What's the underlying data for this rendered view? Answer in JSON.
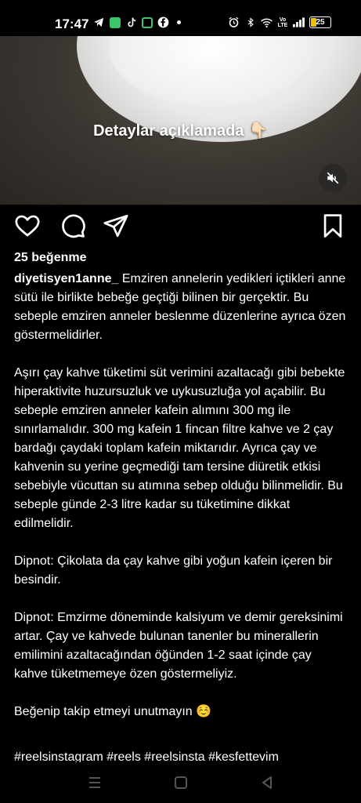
{
  "status_bar": {
    "time": "17:47",
    "battery_level": "25",
    "left_icons": [
      "telegram-icon",
      "messages-icon",
      "tiktok-icon",
      "app-icon",
      "facebook-icon",
      "more-dot"
    ],
    "right_icons": [
      "alarm-icon",
      "bluetooth-icon",
      "wifi-icon",
      "volte-icon",
      "signal-icon",
      "battery-icon"
    ],
    "volte_label": "Vo LTE"
  },
  "video": {
    "overlay_text": "Detaylar açıklamada 👇🏻",
    "muted": true
  },
  "post": {
    "likes_text": "25 beğenme",
    "username": "diyetisyen1anne_",
    "caption_first": "Emziren annelerin yedikleri içtikleri anne sütü ile birlikte bebeğe geçtiği bilinen bir gerçektir. Bu sebeple emziren anneler beslenme düzenlerine ayrıca özen göstermelidirler.",
    "paragraphs": [
      "Aşırı çay kahve tüketimi süt verimini azaltacağı gibi bebekte hiperaktivite huzursuzluk ve uykusuzluğa yol açabilir. Bu sebeple emziren anneler kafein alımını 300 mg ile sınırlamalıdır. 300 mg kafein 1 fincan filtre kahve ve 2 çay bardağı çaydaki toplam kafein miktarıdır. Ayrıca çay ve kahvenin su yerine geçmediği tam tersine diüretik etkisi sebebiyle vücuttan su atımına sebep olduğu bilinmelidir. Bu sebeple günde 2-3 litre kadar su tüketimine dikkat edilmelidir.",
      "Dipnot: Çikolata da çay kahve gibi yoğun kafein içeren bir besindir.",
      "Dipnot: Emzirme döneminde kalsiyum ve demir gereksinimi artar. Çay ve kahvede bulunan tanenler bu minerallerin emilimini azaltacağından öğünden 1-2 saat içinde çay kahve tüketmemeye özen göstermeliyiz.",
      "Beğenip takip etmeyi unutmayın ☺️"
    ],
    "hashtags": "#reelsinstagram #reels #reelsinsta #kesfettevim"
  },
  "colors": {
    "background": "#000000",
    "text": "#ffffff",
    "accent_green": "#3ec26c",
    "battery_yellow": "#f2c200"
  }
}
